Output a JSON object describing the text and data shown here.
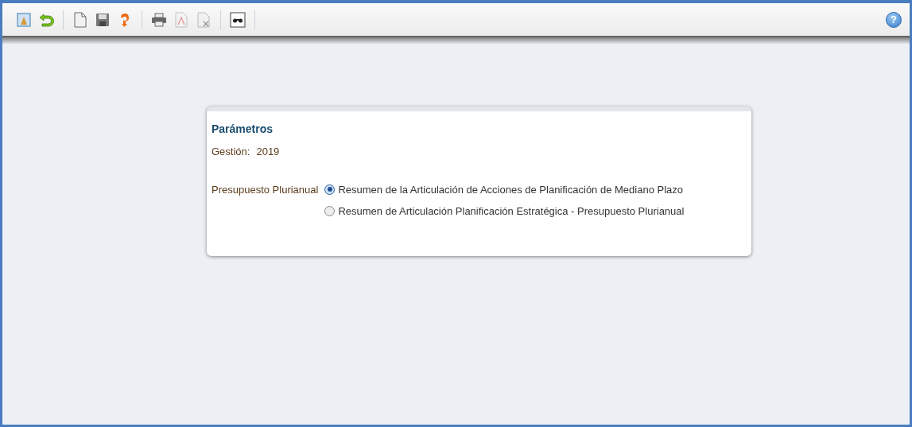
{
  "toolbar": [
    {
      "kind": "picture-frame",
      "disabled": false
    },
    {
      "kind": "undo",
      "disabled": false
    },
    {
      "kind": "separator"
    },
    {
      "kind": "document",
      "disabled": false
    },
    {
      "kind": "save",
      "disabled": false
    },
    {
      "kind": "redo",
      "disabled": false
    },
    {
      "kind": "separator"
    },
    {
      "kind": "print",
      "disabled": false
    },
    {
      "kind": "pdf",
      "disabled": true
    },
    {
      "kind": "export",
      "disabled": true
    },
    {
      "kind": "separator"
    },
    {
      "kind": "binoculars",
      "disabled": false
    },
    {
      "kind": "separator"
    }
  ],
  "help_button": {
    "label": "?"
  },
  "panel": {
    "title": "Parámetros",
    "gestion_label": "Gestión:",
    "gestion_value": "2019",
    "group_label": "Presupuesto Plurianual",
    "options": [
      {
        "label": "Resumen de la Articulación de Acciones de Planificación de Mediano Plazo",
        "selected": true
      },
      {
        "label": "Resumen de Articulación Planificación Estratégica - Presupuesto Plurianual",
        "selected": false
      }
    ]
  }
}
